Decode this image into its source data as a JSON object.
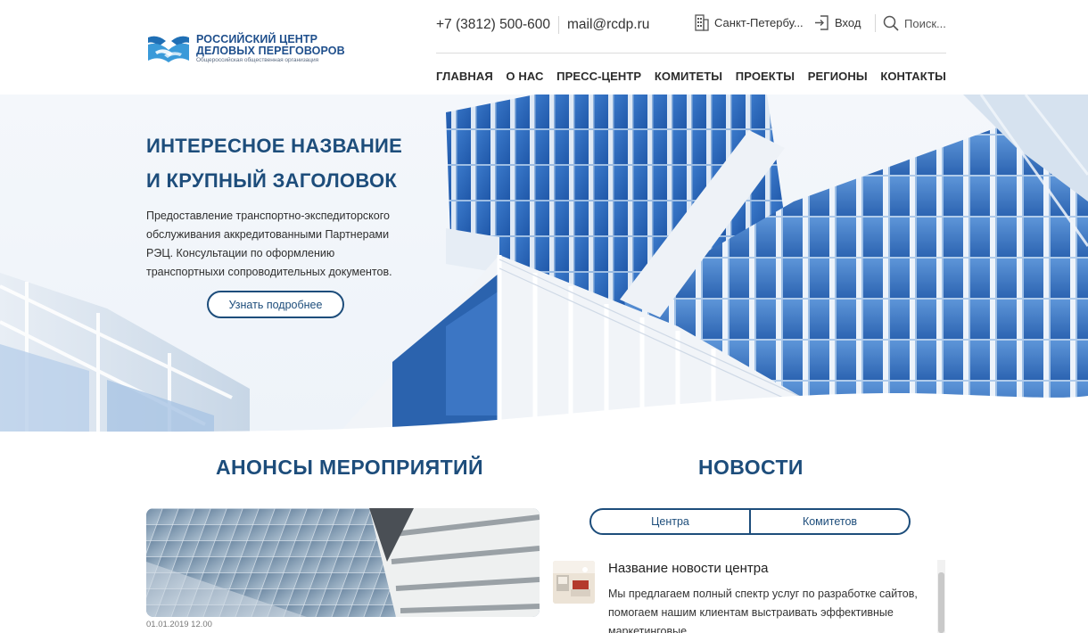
{
  "logo": {
    "line1": "РОССИЙСКИЙ ЦЕНТР",
    "line2": "ДЕЛОВЫХ ПЕРЕГОВОРОВ",
    "sub": "Общероссийская общественная организация"
  },
  "topbar": {
    "phone": "+7 (3812) 500-600",
    "email": "mail@rcdp.ru",
    "city": "Санкт-Петербу...",
    "login": "Вход",
    "search_placeholder": "Поиск..."
  },
  "nav": {
    "items": [
      "ГЛАВНАЯ",
      "О НАС",
      "ПРЕСС-ЦЕНТР",
      "КОМИТЕТЫ",
      "ПРОЕКТЫ",
      "РЕГИОНЫ",
      "КОНТАКТЫ"
    ]
  },
  "hero": {
    "title_line1": "ИНТЕРЕСНОЕ НАЗВАНИЕ",
    "title_line2": "И КРУПНЫЙ ЗАГОЛОВОК",
    "description": "Предоставление транспортно-экспедиторского обслуживания аккредитованными Партнерами РЭЦ. Консультации по оформлению транспортныхи сопроводительных документов.",
    "button": "Узнать подробнее"
  },
  "events": {
    "title": "АНОНСЫ МЕРОПРИЯТИЙ",
    "date": "01.01.2019 12.00"
  },
  "news": {
    "title": "НОВОСТИ",
    "tabs": [
      "Центра",
      "Комитетов"
    ],
    "item": {
      "title": "Название новости центра",
      "text": "Мы предлагаем полный спектр услуг по разработке сайтов, помогаем нашим клиентам выстраивать эффективные маркетинговые."
    }
  },
  "colors": {
    "brand": "#1d4d7b",
    "logo_blue": "#1f4f8c",
    "glass_blue": "#2a66b8"
  },
  "icons": [
    "handshake-logo-icon",
    "building-icon",
    "login-icon",
    "search-icon"
  ]
}
